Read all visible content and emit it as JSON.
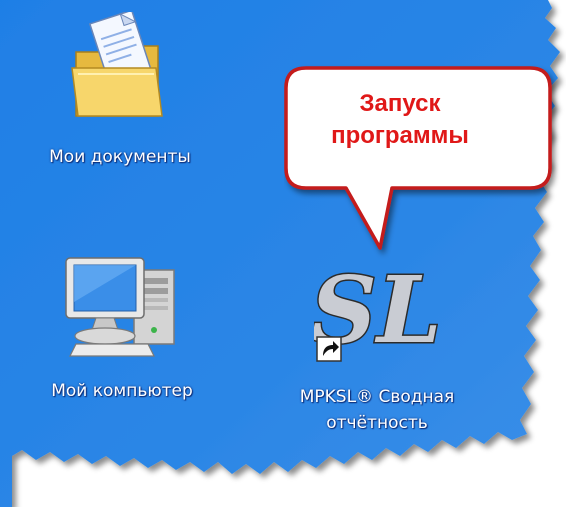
{
  "desktop": {
    "icons": [
      {
        "name": "my-documents",
        "label": "Мои документы"
      },
      {
        "name": "my-computer",
        "label": "Мой компьютер"
      },
      {
        "name": "mpksl-shortcut",
        "label_line1": "MPKSL® Сводная",
        "label_line2": "отчётность",
        "logo_text": "SL"
      }
    ]
  },
  "callout": {
    "line1": "Запуск",
    "line2": "программы"
  },
  "colors": {
    "desktop_blue": "#2b86e6",
    "callout_border": "#c41a1a",
    "callout_text": "#e01818",
    "label_text": "#ffffff"
  }
}
